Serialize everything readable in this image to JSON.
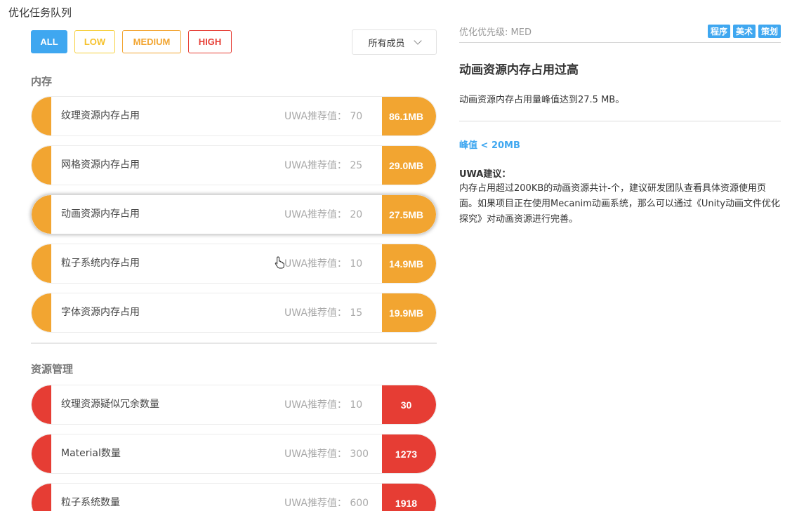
{
  "page_title": "优化任务队列",
  "filters": {
    "all": "ALL",
    "low": "LOW",
    "medium": "MEDIUM",
    "high": "HIGH"
  },
  "member_select": {
    "value": "所有成员"
  },
  "sections": [
    {
      "title": "内存",
      "color": "#f2a531",
      "tasks": [
        {
          "name": "纹理资源内存占用",
          "rec_label": "UWA推荐值：",
          "rec_value": "70",
          "value": "86.1MB"
        },
        {
          "name": "网格资源内存占用",
          "rec_label": "UWA推荐值：",
          "rec_value": "25",
          "value": "29.0MB"
        },
        {
          "name": "动画资源内存占用",
          "rec_label": "UWA推荐值：",
          "rec_value": "20",
          "value": "27.5MB"
        },
        {
          "name": "粒子系统内存占用",
          "rec_label": "UWA推荐值：",
          "rec_value": "10",
          "value": "14.9MB"
        },
        {
          "name": "字体资源内存占用",
          "rec_label": "UWA推荐值：",
          "rec_value": "15",
          "value": "19.9MB"
        }
      ]
    },
    {
      "title": "资源管理",
      "color": "#e63d34",
      "tasks": [
        {
          "name": "纹理资源疑似冗余数量",
          "rec_label": "UWA推荐值：",
          "rec_value": "10",
          "value": "30"
        },
        {
          "name": "Material数量",
          "rec_label": "UWA推荐值：",
          "rec_value": "300",
          "value": "1273"
        },
        {
          "name": "粒子系统数量",
          "rec_label": "UWA推荐值：",
          "rec_value": "600",
          "value": "1918"
        }
      ]
    }
  ],
  "detail": {
    "priority": "优化优先级: MED",
    "tags": [
      "程序",
      "美术",
      "策划"
    ],
    "title": "动画资源内存占用过高",
    "description": "动画资源内存占用量峰值达到27.5 MB。",
    "peak": "峰值 < 20MB",
    "advice_head": "UWA建议：",
    "advice_body": "内存占用超过200KB的动画资源共计-个，建议研发团队查看具体资源使用页面。如果项目正在使用Mecanim动画系统，那么可以通过《Unity动画文件优化探究》对动画资源进行完善。"
  },
  "colors": {
    "accent": "#3fa7f0",
    "medium": "#f2a531",
    "high": "#e63d34",
    "low": "#f6cf3c"
  }
}
